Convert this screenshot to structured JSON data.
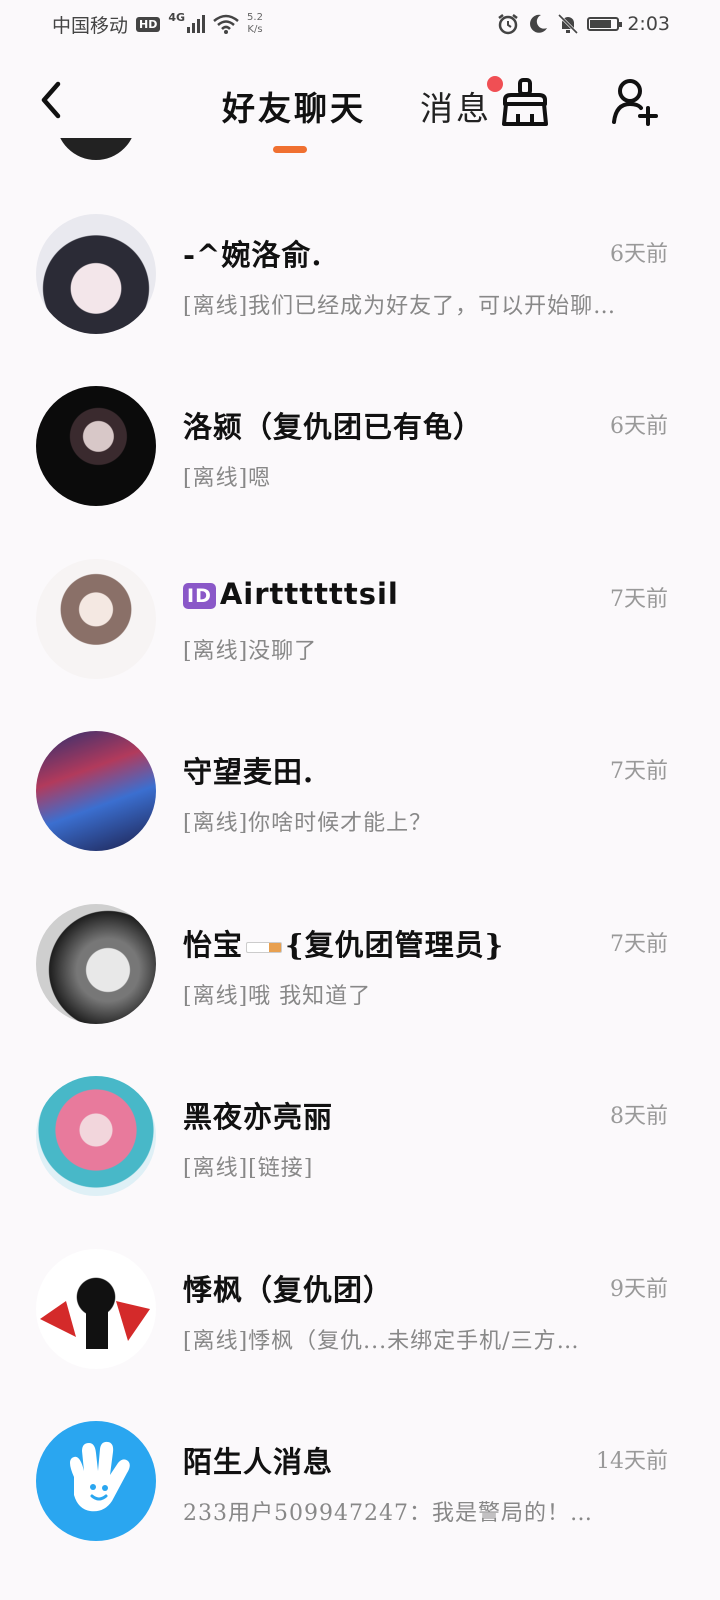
{
  "status_bar": {
    "carrier": "中国移动",
    "hd": "HD",
    "network": "4G",
    "speed_value": "5.2",
    "speed_unit": "K/s",
    "time": "2:03"
  },
  "nav": {
    "tabs": [
      {
        "label": "好友聊天",
        "active": true
      },
      {
        "label": "消息",
        "active": false
      }
    ],
    "accent_color": "#f07030",
    "notify_color": "#f04f54"
  },
  "conversations": [
    {
      "name": "-^婉洛俞.",
      "time": "6天前",
      "status": "[离线]",
      "preview": "我们已经成为好友了，可以开始聊…"
    },
    {
      "name": "洛颍（复仇团已有龟）",
      "time": "6天前",
      "status": "[离线]",
      "preview": "嗯"
    },
    {
      "badge": "ID",
      "name": "Airttttttsil",
      "time": "7天前",
      "status": "[离线]",
      "preview": "没聊了"
    },
    {
      "name": "守望麦田.",
      "time": "7天前",
      "status": "[离线]",
      "preview": "你啥时候才能上？"
    },
    {
      "name_prefix": "怡宝",
      "name": "{复仇团管理员}",
      "time": "7天前",
      "status": "[离线]",
      "preview": "哦 我知道了"
    },
    {
      "name": "黑夜亦亮丽",
      "time": "8天前",
      "status": "[离线]",
      "preview": "[链接]"
    },
    {
      "name": "悸枫（复仇团）",
      "time": "9天前",
      "status": "[离线]",
      "preview": "悸枫（复仇...未绑定手机/三方…"
    },
    {
      "name": "陌生人消息",
      "time": "14天前",
      "status": "",
      "preview": "233用户509947247：我是警局的！…"
    }
  ]
}
